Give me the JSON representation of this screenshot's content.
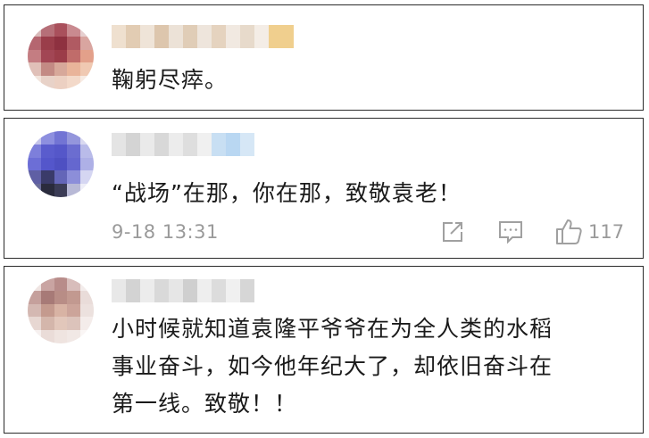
{
  "comments": [
    {
      "text": "鞠躬尽瘁。"
    },
    {
      "text": "“战场”在那，你在那，致敬袁老！",
      "time": "9-18 13:31",
      "likes": "117"
    },
    {
      "lines": [
        "小时候就知道袁隆平爷爷在为全人类的水稻",
        "事业奋斗，如今他年纪大了，却依旧奋斗在",
        "第一线。致敬！！"
      ]
    }
  ],
  "icons": {
    "share": "share-icon",
    "comment": "comment-icon",
    "like": "thumbs-up-icon"
  },
  "colors": {
    "border": "#2b2b2b",
    "text": "#1a1a1a",
    "meta": "#9a9a9a"
  }
}
